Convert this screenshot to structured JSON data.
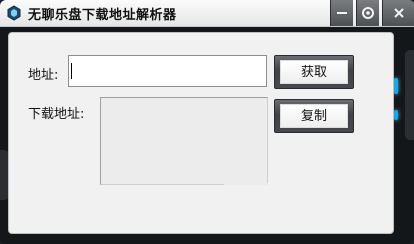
{
  "window": {
    "title": "无聊乐盘下载地址解析器",
    "icons": [
      "app-icon",
      "minimize-icon",
      "settings-icon",
      "close-icon"
    ],
    "accent": "#19a7e6"
  },
  "form": {
    "address_label": "地址:",
    "address_value": "",
    "download_label": "下载地址:",
    "download_value": ""
  },
  "buttons": {
    "fetch": "获取",
    "copy": "复制"
  }
}
